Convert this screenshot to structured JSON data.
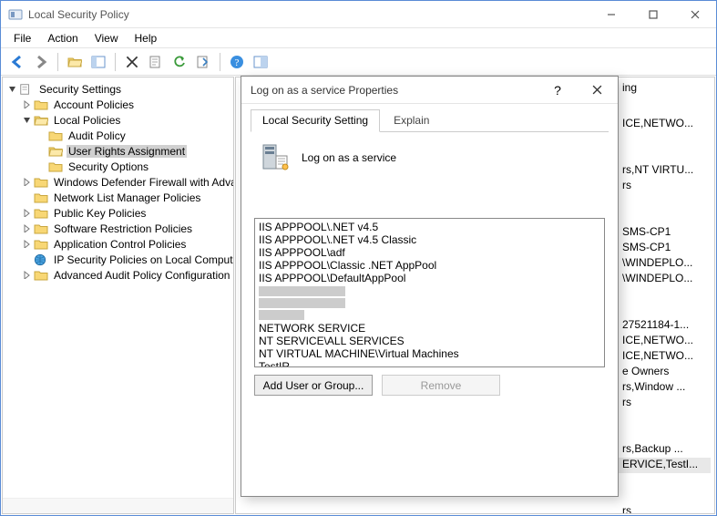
{
  "window": {
    "title": "Local Security Policy"
  },
  "menu": {
    "file": "File",
    "action": "Action",
    "view": "View",
    "help": "Help"
  },
  "tree": {
    "root": "Security Settings",
    "account_policies": "Account Policies",
    "local_policies": "Local Policies",
    "audit_policy": "Audit Policy",
    "user_rights": "User Rights Assignment",
    "security_options": "Security Options",
    "firewall": "Windows Defender Firewall with Advanced Security",
    "netlist": "Network List Manager Policies",
    "pubkey": "Public Key Policies",
    "softrestrict": "Software Restriction Policies",
    "appcontrol": "Application Control Policies",
    "ipsec": "IP Security Policies on Local Computer",
    "advaudit": "Advanced Audit Policy Configuration"
  },
  "list_fragments": {
    "r0": "ing",
    "r1": "ICE,NETWO...",
    "r2": "rs,NT VIRTU...",
    "r3": "rs",
    "r4": "SMS-CP1",
    "r5": "SMS-CP1",
    "r6": "\\WINDEPLO...",
    "r7": "\\WINDEPLO...",
    "r8": "27521184-1...",
    "r9": "ICE,NETWO...",
    "r10": "ICE,NETWO...",
    "r11": "e Owners",
    "r12": "rs,Window ...",
    "r13": "rs",
    "r14": "rs,Backup ...",
    "r15": "ERVICE,TestI...",
    "r16": "rs"
  },
  "dialog": {
    "title": "Log on as a service Properties",
    "tab_local": "Local Security Setting",
    "tab_explain": "Explain",
    "policy_name": "Log on as a service",
    "principals": {
      "p0": "IIS APPPOOL\\.NET v4.5",
      "p1": "IIS APPPOOL\\.NET v4.5 Classic",
      "p2": "IIS APPPOOL\\adf",
      "p3": "IIS APPPOOL\\Classic .NET AppPool",
      "p4": "IIS APPPOOL\\DefaultAppPool",
      "p5": "NETWORK SERVICE",
      "p6": "NT SERVICE\\ALL SERVICES",
      "p7": "NT VIRTUAL MACHINE\\Virtual Machines",
      "p8": "TestIR"
    },
    "add_btn": "Add User or Group...",
    "remove_btn": "Remove"
  }
}
